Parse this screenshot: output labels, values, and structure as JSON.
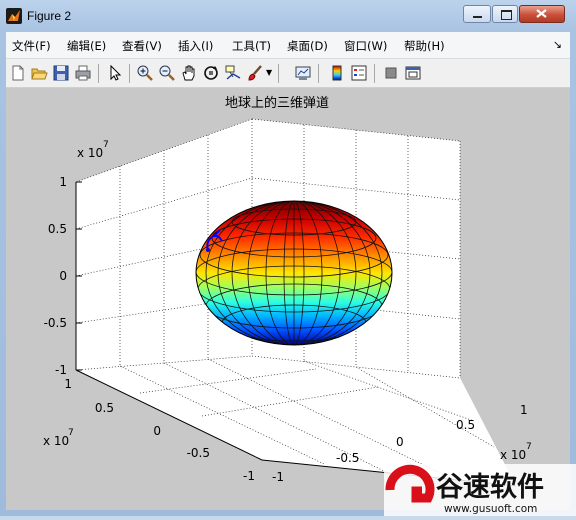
{
  "window": {
    "title": "Figure 2"
  },
  "menu": [
    {
      "label": "文件(F)"
    },
    {
      "label": "编辑(E)"
    },
    {
      "label": "查看(V)"
    },
    {
      "label": "插入(I)"
    },
    {
      "label": "工具(T)"
    },
    {
      "label": "桌面(D)"
    },
    {
      "label": "窗口(W)"
    },
    {
      "label": "帮助(H)"
    }
  ],
  "toolbar": {
    "icons": [
      "new-figure-icon",
      "open-file-icon",
      "save-icon",
      "print-icon",
      "select-arrow-icon",
      "zoom-in-icon",
      "zoom-out-icon",
      "pan-hand-icon",
      "rotate-3d-icon",
      "data-cursor-icon",
      "brush-icon",
      "link-plot-icon",
      "colorbar-icon",
      "legend-icon",
      "hide-tools-icon",
      "show-tools-icon"
    ]
  },
  "plot": {
    "title": "地球上的三维弹道",
    "z_exponent_label": "x 10",
    "z_exponent": "7",
    "x_exponent_label": "x 10",
    "x_exponent": "7",
    "y_exponent_label": "x 10",
    "y_exponent": "7",
    "z_ticks": [
      "1",
      "0.5",
      "0",
      "-0.5",
      "-1"
    ],
    "x_ticks": [
      "1",
      "0.5",
      "0",
      "-0.5",
      "-1"
    ],
    "y_ticks": [
      "1",
      "0.5",
      "0",
      "-0.5",
      "-1"
    ],
    "surface_colormap": [
      "#000080",
      "#0000ff",
      "#0080ff",
      "#00ffff",
      "#80ff80",
      "#ffff00",
      "#ff8000",
      "#ff0000",
      "#800000"
    ],
    "trajectory_color": "#0000ff"
  },
  "watermark": {
    "brand": "谷速软件",
    "url": "www.gusuoft.com"
  }
}
